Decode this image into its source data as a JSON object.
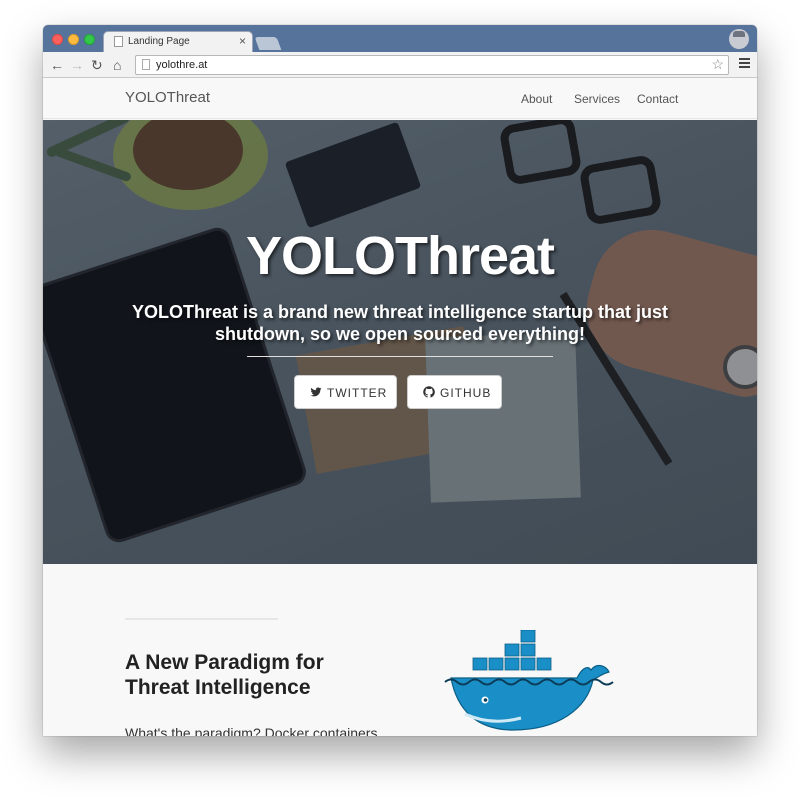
{
  "browser": {
    "tab_title": "Landing Page",
    "tab_close": "×",
    "url": "yolothre.at"
  },
  "navbar": {
    "brand": "YOLOThreat",
    "links": [
      "About",
      "Services",
      "Contact"
    ]
  },
  "hero": {
    "title": "YOLOThreat",
    "subtitle": "YOLOThreat is a brand new threat intelligence startup that just shutdown, so we open sourced everything!",
    "buttons": [
      {
        "label": "TWITTER",
        "icon": "twitter-icon"
      },
      {
        "label": "GITHUB",
        "icon": "github-icon"
      }
    ]
  },
  "section": {
    "heading": "A New Paradigm for Threat Intelligence",
    "lead": "What's the paradigm? Docker containers",
    "image": "docker-whale-logo"
  },
  "colors": {
    "chrome_tabstrip": "#56739c",
    "docker_blue": "#1a8fc7",
    "page_bg": "#f8f8f8"
  }
}
